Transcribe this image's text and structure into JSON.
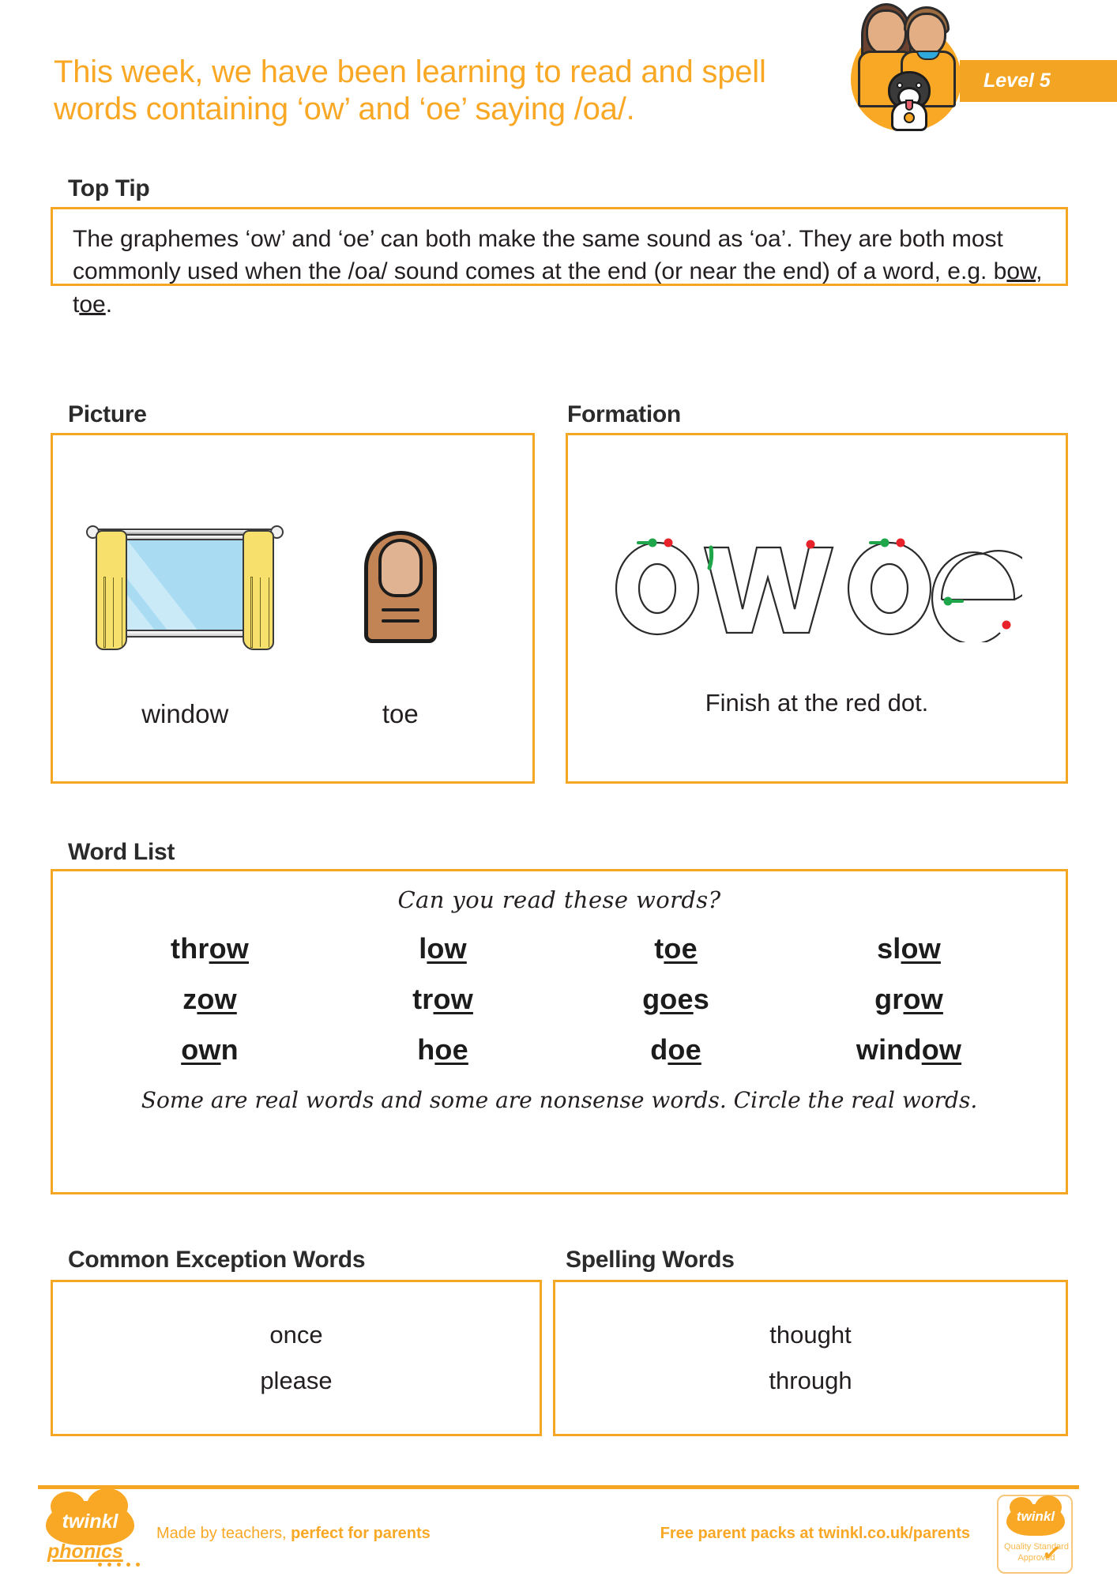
{
  "header": {
    "title": "This week, we have been learning to read and spell words containing ‘ow’ and ‘oe’ saying /oa/.",
    "level_badge": "Level 5",
    "logo_name": "twinkl-phonics-kids-logo"
  },
  "top_tip": {
    "heading": "Top Tip",
    "body_part1": "The graphemes ‘ow’ and ‘oe’ can both make the same sound as ‘oa’. They are both most commonly used when the /oa/ sound comes at the end (or near the end) of a word, e.g. b",
    "example1_underline": "ow",
    "body_part2": ", t",
    "example2_underline": "oe",
    "body_part3": "."
  },
  "picture": {
    "heading": "Picture",
    "items": [
      {
        "label": "window",
        "art": "window-illustration"
      },
      {
        "label": "toe",
        "art": "toe-illustration"
      }
    ]
  },
  "formation": {
    "heading": "Formation",
    "graphemes": [
      "ow",
      "oe"
    ],
    "caption": "Finish at the red dot.",
    "start_dot_color": "#1FA64A",
    "end_dot_color": "#E8222A"
  },
  "word_list": {
    "heading": "Word List",
    "prompt": "Can you read these words?",
    "note": "Some are real words and some are nonsense words. Circle the real words.",
    "words": [
      {
        "pre": "thr",
        "mid": "ow",
        "post": ""
      },
      {
        "pre": "l",
        "mid": "ow",
        "post": ""
      },
      {
        "pre": "t",
        "mid": "oe",
        "post": ""
      },
      {
        "pre": "sl",
        "mid": "ow",
        "post": ""
      },
      {
        "pre": "z",
        "mid": "ow",
        "post": ""
      },
      {
        "pre": "tr",
        "mid": "ow",
        "post": ""
      },
      {
        "pre": "g",
        "mid": "oe",
        "post": "s"
      },
      {
        "pre": "gr",
        "mid": "ow",
        "post": ""
      },
      {
        "pre": "",
        "mid": "ow",
        "post": "n"
      },
      {
        "pre": "h",
        "mid": "oe",
        "post": ""
      },
      {
        "pre": "d",
        "mid": "oe",
        "post": ""
      },
      {
        "pre": "wind",
        "mid": "ow",
        "post": ""
      }
    ]
  },
  "common_exception_words": {
    "heading": "Common Exception Words",
    "words": [
      "once",
      "please"
    ]
  },
  "spelling_words": {
    "heading": "Spelling Words",
    "words": [
      "thought",
      "through"
    ]
  },
  "footer": {
    "brand_line1": "twinkl",
    "brand_line2": "phonics",
    "left_text_normal": "Made by teachers, ",
    "left_text_bold": "perfect for parents",
    "right_text": "Free parent packs at twinkl.co.uk/parents",
    "quality_badge_brand": "twinkl",
    "quality_badge_line1": "Quality Standard",
    "quality_badge_line2": "Approved"
  },
  "colors": {
    "accent_orange": "#F5A623",
    "title_orange": "#F9A826",
    "text_dark": "#231f20"
  }
}
